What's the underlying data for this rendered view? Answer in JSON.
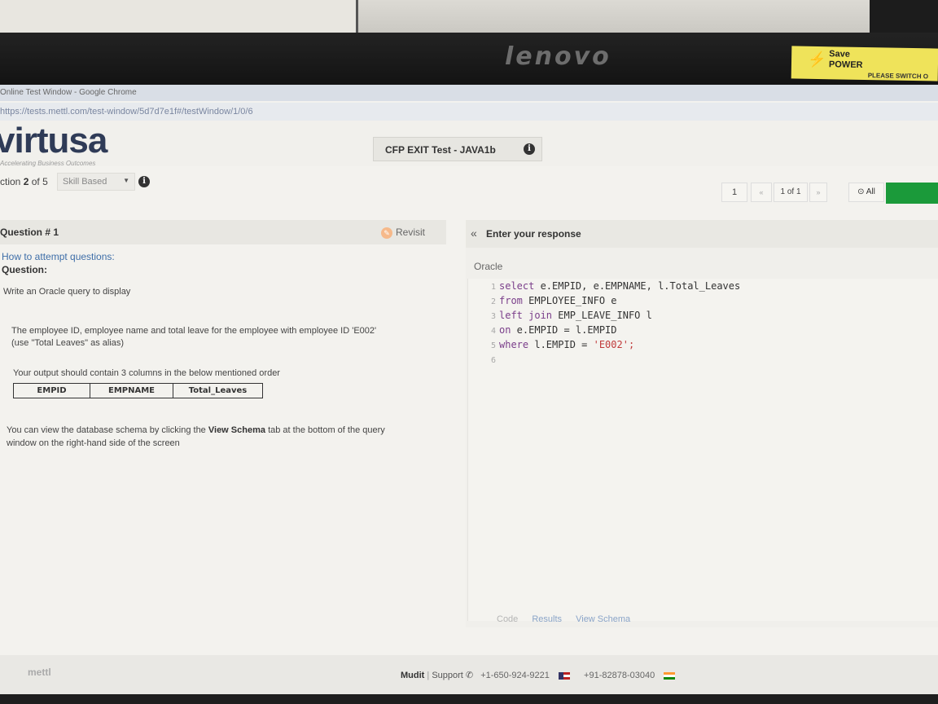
{
  "monitor": {
    "brand": "lenovo",
    "sticker_line1": "Save",
    "sticker_line2": "POWER",
    "sticker_line3": "PLEASE SWITCH O"
  },
  "browser": {
    "title": "Online Test Window - Google Chrome",
    "url": "https://tests.mettl.com/test-window/5d7d7e1f#/testWindow/1/0/6"
  },
  "header": {
    "logo": "virtusa",
    "tagline": "Accelerating Business Outcomes",
    "test_title": "CFP EXIT Test - JAVA1b"
  },
  "section": {
    "prefix": "ction",
    "current": "2",
    "of": "of 5",
    "skill": "Skill Based"
  },
  "pager": {
    "number": "1",
    "prev": "«",
    "of": "1 of 1",
    "next": "»",
    "all": "All"
  },
  "question": {
    "number": "Question # 1",
    "revisit": "Revisit",
    "how": "How to attempt questions:",
    "label": "Question:",
    "p1": "Write an Oracle query to display",
    "p2": "The employee ID, employee name and total leave for the employee with employee ID 'E002'",
    "p3": "(use \"Total Leaves\" as alias)",
    "p4": "Your output should contain 3 columns in the below mentioned order",
    "columns": [
      "EMPID",
      "EMPNAME",
      "Total_Leaves"
    ],
    "p5_before": "You can view the database schema by clicking the",
    "p5_bold": "View Schema",
    "p5_after": "tab at the bottom of the query",
    "p6": "window on the right-hand side of the screen"
  },
  "response": {
    "title": "Enter your response",
    "language": "Oracle",
    "code_lines": [
      {
        "n": "1",
        "kw": "select",
        "rest": " e.EMPID, e.EMPNAME, l.Total_Leaves",
        "str": ""
      },
      {
        "n": "2",
        "kw": "from",
        "rest": " EMPLOYEE_INFO e",
        "str": ""
      },
      {
        "n": "3",
        "kw": "left join",
        "rest": " EMP_LEAVE_INFO l",
        "str": ""
      },
      {
        "n": "4",
        "kw": "on",
        "rest": " e.EMPID = l.EMPID",
        "str": ""
      },
      {
        "n": "5",
        "kw": "where",
        "rest": " l.EMPID = ",
        "str": "'E002';"
      },
      {
        "n": "6",
        "kw": "",
        "rest": "",
        "str": ""
      }
    ],
    "tabs": [
      "Code",
      "Results",
      "View Schema"
    ]
  },
  "footer": {
    "logo": "mettl",
    "user": "Mudit",
    "support": "Support",
    "phone_us": "+1-650-924-9221",
    "phone_in": "+91-82878-03040"
  }
}
